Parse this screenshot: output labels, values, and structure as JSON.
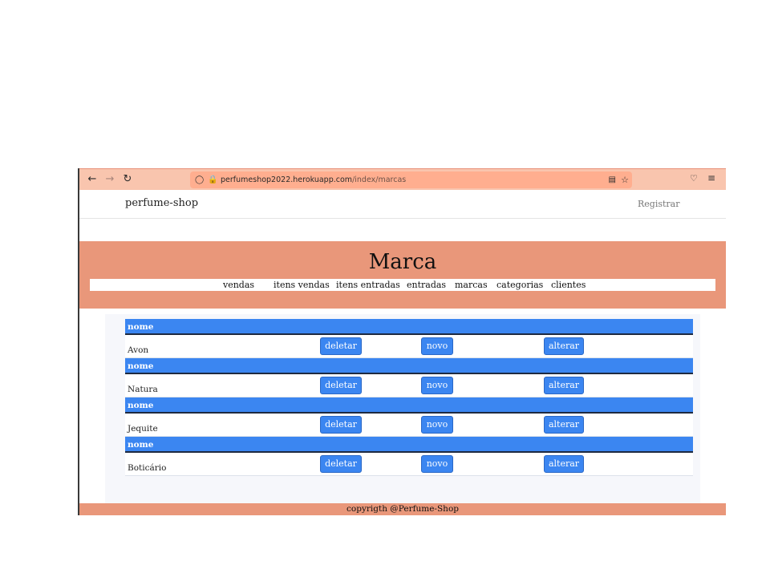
{
  "browser": {
    "url_host": "perfumeshop2022.herokuapp.com",
    "url_path": "/index/marcas"
  },
  "site": {
    "brand": "perfume-shop",
    "register_label": "Registrar"
  },
  "hero": {
    "title": "Marca"
  },
  "menu": [
    {
      "label": "vendas"
    },
    {
      "label": "itens vendas"
    },
    {
      "label": "itens entradas"
    },
    {
      "label": "entradas"
    },
    {
      "label": "marcas"
    },
    {
      "label": "categorias"
    },
    {
      "label": "clientes"
    }
  ],
  "table": {
    "header_label": "nome",
    "rows": [
      {
        "nome": "Avon"
      },
      {
        "nome": "Natura"
      },
      {
        "nome": "Jequite"
      },
      {
        "nome": "Boticário"
      }
    ],
    "delete_label": "deletar",
    "new_label": "novo",
    "edit_label": "alterar"
  },
  "footer": {
    "text": "copyrigth @Perfume-Shop"
  },
  "colors": {
    "accent": "#e9977a",
    "button": "#3b86f1"
  },
  "icons": [
    "back-icon",
    "forward-icon",
    "reload-icon",
    "shield-icon",
    "lock-icon",
    "reader-view-icon",
    "bookmark-star-icon",
    "pocket-icon",
    "hamburger-menu-icon"
  ]
}
